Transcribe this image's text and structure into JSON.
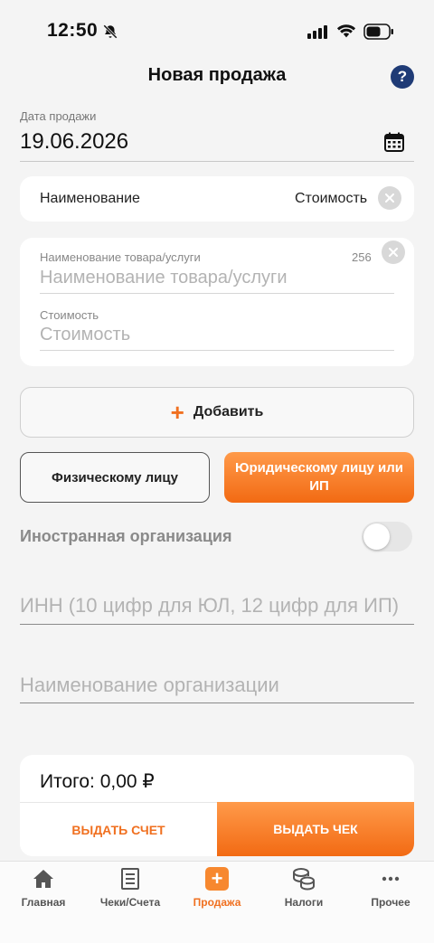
{
  "status_bar": {
    "time": "12:50"
  },
  "header": {
    "title": "Новая продажа",
    "help_label": "?"
  },
  "sale_date": {
    "label": "Дата продажи",
    "value": "19.06.2026"
  },
  "items_header": {
    "name_col": "Наименование",
    "cost_col": "Стоимость"
  },
  "item": {
    "name_label": "Наименование товара/услуги",
    "name_placeholder": "Наименование товара/услуги",
    "name_counter": "256",
    "cost_label": "Стоимость",
    "cost_placeholder": "Стоимость"
  },
  "add_button": {
    "icon": "+",
    "label": "Добавить"
  },
  "buyer_type": {
    "individual": "Физическому лицу",
    "legal": "Юридическому лицу или ИП",
    "selected": "legal"
  },
  "foreign_org": {
    "label": "Иностранная организация",
    "enabled": false
  },
  "inn_field": {
    "placeholder": "ИНН (10 цифр для ЮЛ, 12 цифр для ИП)"
  },
  "org_name_field": {
    "placeholder": "Наименование организации"
  },
  "total": {
    "text": "Итого: 0,00 ₽"
  },
  "actions": {
    "invoice_label": "ВЫДАТЬ СЧЕТ",
    "receipt_label": "ВЫДАТЬ ЧЕК"
  },
  "tabbar": {
    "active": "sale",
    "items": [
      {
        "id": "home",
        "label": "Главная",
        "icon": "home-icon"
      },
      {
        "id": "receipts",
        "label": "Чеки/Счета",
        "icon": "receipt-icon"
      },
      {
        "id": "sale",
        "label": "Продажа",
        "icon": "plus-square-icon"
      },
      {
        "id": "taxes",
        "label": "Налоги",
        "icon": "coins-icon"
      },
      {
        "id": "more",
        "label": "Прочее",
        "icon": "more-icon"
      }
    ]
  },
  "colors": {
    "accent": "#f07020",
    "accent_gradient_top": "#ff9a4a",
    "help_button": "#1f3b76",
    "background": "#f4f4f4"
  }
}
